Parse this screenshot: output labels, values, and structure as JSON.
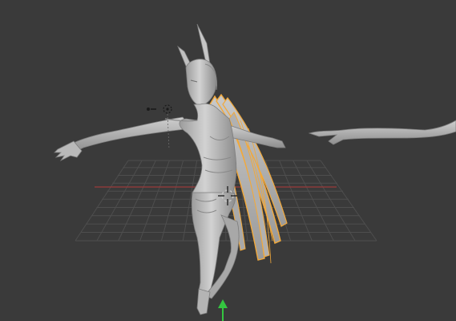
{
  "viewport": {
    "background_color": "#3a3a3a",
    "grid_color": "#4e4e4e",
    "x_axis_color": "#b03a3a",
    "z_axis_color": "#34c640",
    "selection_outline_color": "#f2a93b",
    "model_color": "#bdbdbd"
  },
  "icons": {
    "3d_cursor": "3d-cursor-icon",
    "light": "light-icon",
    "manipulator": "z-axis-arrow-icon"
  }
}
